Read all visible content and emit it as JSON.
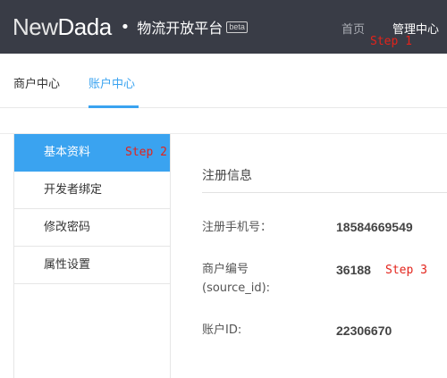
{
  "header": {
    "logo_new": "New",
    "logo_dada": "Dada",
    "logo_dot": "•",
    "platform": "物流开放平台",
    "beta": "beta",
    "nav": {
      "home": "首页",
      "manage": "管理中心"
    }
  },
  "annotations": {
    "step1": "Step 1",
    "step2": "Step 2",
    "step3": "Step 3"
  },
  "subnav": {
    "merchant": "商户中心",
    "account": "账户中心"
  },
  "sidebar": {
    "items": [
      {
        "label": "基本资料"
      },
      {
        "label": "开发者绑定"
      },
      {
        "label": "修改密码"
      },
      {
        "label": "属性设置"
      }
    ]
  },
  "main": {
    "section_title": "注册信息",
    "fields": [
      {
        "label": "注册手机号：",
        "value": "18584669549"
      },
      {
        "label_line1": "商户编号",
        "label_line2": "(source_id):",
        "value": "36188"
      },
      {
        "label": "账户ID:",
        "value": "22306670"
      }
    ]
  },
  "colors": {
    "header_bg": "#393c46",
    "accent": "#3aa3f0",
    "annotation": "#e3231b"
  }
}
